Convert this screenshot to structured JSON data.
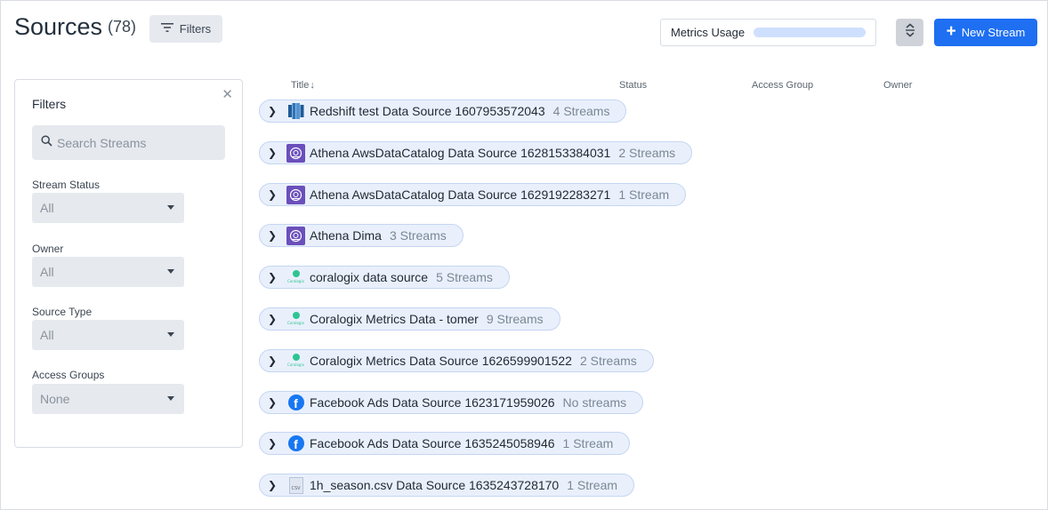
{
  "header": {
    "title": "Sources",
    "count": "(78)",
    "filters_button": "Filters",
    "metrics_label": "Metrics Usage",
    "metrics_usage_fraction": 0.0,
    "new_stream_label": "New Stream",
    "accent_color": "#1e6ff2"
  },
  "filter_panel": {
    "title": "Filters",
    "close_icon": "close-icon",
    "search_placeholder": "Search Streams",
    "stream_status_label": "Stream Status",
    "stream_status_value": "All",
    "owner_label": "Owner",
    "owner_value": "All",
    "source_type_label": "Source Type",
    "source_type_value": "All",
    "access_groups_label": "Access Groups",
    "access_groups_value": "None"
  },
  "table": {
    "columns": [
      "Title",
      "Status",
      "Access Group",
      "Owner"
    ],
    "sort_indicator": "↓",
    "rows": [
      {
        "icon": "redshift-icon",
        "name": "Redshift test Data Source 1607953572043",
        "count": "4 Streams"
      },
      {
        "icon": "athena-icon",
        "name": "Athena AwsDataCatalog Data Source 1628153384031",
        "count": "2 Streams"
      },
      {
        "icon": "athena-icon",
        "name": "Athena AwsDataCatalog Data Source 1629192283271",
        "count": "1 Stream"
      },
      {
        "icon": "athena-icon",
        "name": "Athena Dima",
        "count": "3 Streams"
      },
      {
        "icon": "coralogix-icon",
        "name": "coralogix data source",
        "count": "5 Streams"
      },
      {
        "icon": "coralogix-icon",
        "name": "Coralogix Metrics Data - tomer",
        "count": "9 Streams"
      },
      {
        "icon": "coralogix-icon",
        "name": "Coralogix Metrics Data Source 1626599901522",
        "count": "2 Streams"
      },
      {
        "icon": "facebook-icon",
        "name": "Facebook Ads Data Source 1623171959026",
        "count": "No streams"
      },
      {
        "icon": "facebook-icon",
        "name": "Facebook Ads Data Source 1635245058946",
        "count": "1 Stream"
      },
      {
        "icon": "csv-icon",
        "name": "1h_season.csv Data Source 1635243728170",
        "count": "1 Stream"
      }
    ]
  },
  "icon_text": {
    "coralogix": "Coralogix",
    "facebook": "f",
    "csv": "CSV"
  }
}
